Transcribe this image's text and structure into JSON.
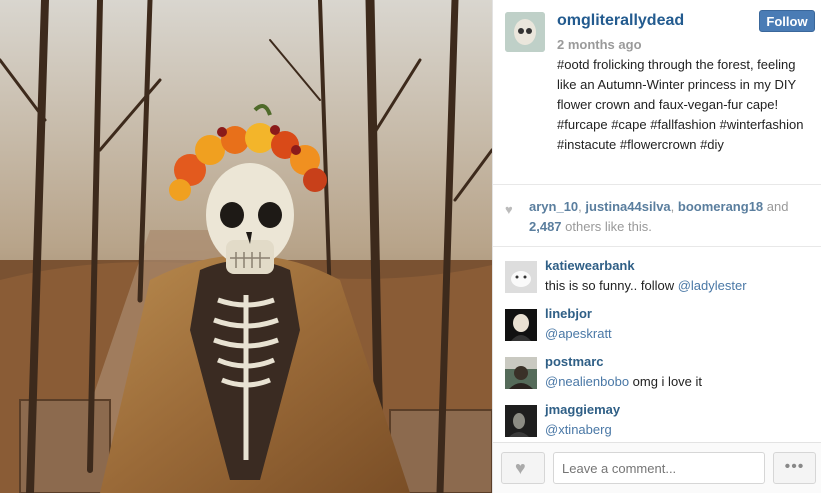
{
  "post": {
    "username": "omgliterallydead",
    "timestamp": "2 months ago",
    "follow_label": "Follow",
    "caption": "#ootd frolicking through the forest, feeling like an Autumn-Winter princess in my DIY flower crown and faux-vegan-fur cape! #furcape #cape #fallfashion #winterfashion #instacute #flowercrown #diy",
    "photo_icon": "skeleton-in-fur-cape-photo"
  },
  "likes": {
    "icon": "heart-icon",
    "users": [
      "aryn_10",
      "justina44silva",
      "boomerang18"
    ],
    "sep1": ", ",
    "sep2": ", ",
    "and_text": " and",
    "count": "2,487",
    "suffix": " others like this."
  },
  "comments": [
    {
      "user": "katiewearbank",
      "mention": "",
      "text": "this is so funny.. follow ",
      "mention_after": "@ladylester"
    },
    {
      "user": "linebjor",
      "mention": "@apeskratt",
      "text": "",
      "mention_after": ""
    },
    {
      "user": "postmarc",
      "mention": "@nealienbobo",
      "text": " omg i love it",
      "mention_after": ""
    },
    {
      "user": "jmaggiemay",
      "mention": "@xtinaberg",
      "text": "",
      "mention_after": ""
    }
  ],
  "footer": {
    "comment_placeholder": "Leave a comment...",
    "more_label": "•••",
    "like_icon": "heart-icon"
  },
  "colors": {
    "username": "#235b8f",
    "follow_bg": "#4a7cb5",
    "mention": "#4a78a6"
  }
}
